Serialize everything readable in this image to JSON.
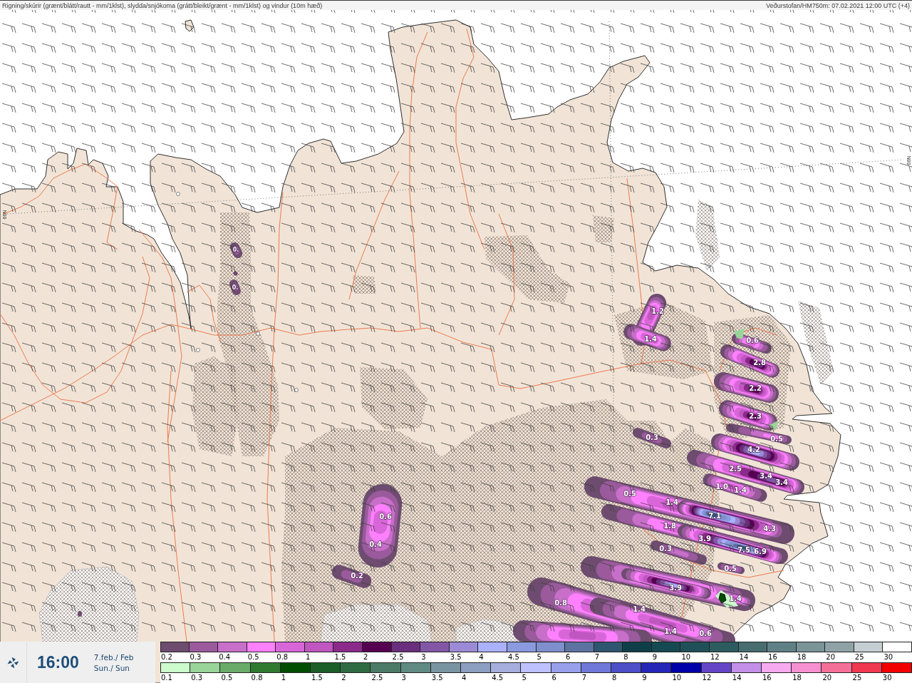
{
  "header": {
    "title": "Rigning/skúrir (grænt/blátt/rautt - mm/1klst), slydda/snjókoma (grátt/bleikt/grænt - mm/1klst) og vindur (10m hæð)",
    "source": "Veðurstofan/HM750m: 07.02.2021 12:00 UTC (+4)"
  },
  "map": {
    "grid_labels": [
      "66N",
      "66N"
    ],
    "precipitation_labels": [
      "0.",
      "0.",
      "1.2",
      "1.4",
      "0.6",
      "2.8",
      "2.2",
      "2.3",
      "0.3",
      "0.5",
      "4.2",
      "2.5",
      "3.4",
      "3.4",
      "1.0",
      "1.4",
      "0.5",
      "1.4",
      "7.1",
      "0.6",
      "1.8",
      "4.3",
      "3.9",
      "0.4",
      "0.3",
      "7.5",
      "6.9",
      "0.5",
      "0.2",
      "3.9",
      "1.4",
      "0.8",
      "1.4",
      "1.4",
      "0.6"
    ]
  },
  "time_panel": {
    "time": "16:00",
    "date": "7.feb./ Feb",
    "weekday": "Sun./ Sun"
  },
  "legend": {
    "sleet_snow": [
      {
        "label": "0.2",
        "color": "#6d4c6f"
      },
      {
        "label": "0.3",
        "color": "#9a5a9c"
      },
      {
        "label": "0.4",
        "color": "#c76fc9"
      },
      {
        "label": "0.5",
        "color": "#ff80ff"
      },
      {
        "label": "0.8",
        "color": "#d966d9"
      },
      {
        "label": "1",
        "color": "#c056c0"
      },
      {
        "label": "1.5",
        "color": "#8b2a8b"
      },
      {
        "label": "2",
        "color": "#560052"
      },
      {
        "label": "2.5",
        "color": "#6a2e7c"
      },
      {
        "label": "3",
        "color": "#8257a6"
      },
      {
        "label": "3.5",
        "color": "#9b8ad5"
      },
      {
        "label": "4",
        "color": "#aab1fe"
      },
      {
        "label": "4.5",
        "color": "#8a9ade"
      },
      {
        "label": "5",
        "color": "#7f8fcd"
      },
      {
        "label": "6",
        "color": "#5c72a0"
      },
      {
        "label": "7",
        "color": "#2f5670"
      },
      {
        "label": "8",
        "color": "#0e3f48"
      },
      {
        "label": "9",
        "color": "#154a52"
      },
      {
        "label": "10",
        "color": "#1f5058"
      },
      {
        "label": "12",
        "color": "#2d5c60"
      },
      {
        "label": "14",
        "color": "#476d70"
      },
      {
        "label": "16",
        "color": "#5f8185"
      },
      {
        "label": "18",
        "color": "#7a9498"
      },
      {
        "label": "20",
        "color": "#8fa3a7"
      },
      {
        "label": "25",
        "color": "#c5ced2"
      },
      {
        "label": "30",
        "color": "#ffffff"
      }
    ],
    "rain": [
      {
        "label": "0.1",
        "color": "#ccfccc"
      },
      {
        "label": "0.3",
        "color": "#99d499"
      },
      {
        "label": "0.5",
        "color": "#6aab6a"
      },
      {
        "label": "0.8",
        "color": "#2f7a2f"
      },
      {
        "label": "1",
        "color": "#004d00"
      },
      {
        "label": "1.5",
        "color": "#1b5e27"
      },
      {
        "label": "2",
        "color": "#2f6b42"
      },
      {
        "label": "2.5",
        "color": "#4b7b67"
      },
      {
        "label": "3",
        "color": "#5f8b82"
      },
      {
        "label": "3.5",
        "color": "#7a95a2"
      },
      {
        "label": "4",
        "color": "#8d9fc1"
      },
      {
        "label": "4.5",
        "color": "#a5aedd"
      },
      {
        "label": "5",
        "color": "#bdc1ff"
      },
      {
        "label": "6",
        "color": "#98a0ec"
      },
      {
        "label": "7",
        "color": "#6f78d8"
      },
      {
        "label": "8",
        "color": "#4c4fc8"
      },
      {
        "label": "9",
        "color": "#2626b8"
      },
      {
        "label": "10",
        "color": "#0000a8"
      },
      {
        "label": "12",
        "color": "#6545c6"
      },
      {
        "label": "14",
        "color": "#c48fe8"
      },
      {
        "label": "16",
        "color": "#f8aaf0"
      },
      {
        "label": "18",
        "color": "#f790d0"
      },
      {
        "label": "20",
        "color": "#f57098"
      },
      {
        "label": "25",
        "color": "#f0384f"
      },
      {
        "label": "30",
        "color": "#f20000"
      }
    ]
  }
}
